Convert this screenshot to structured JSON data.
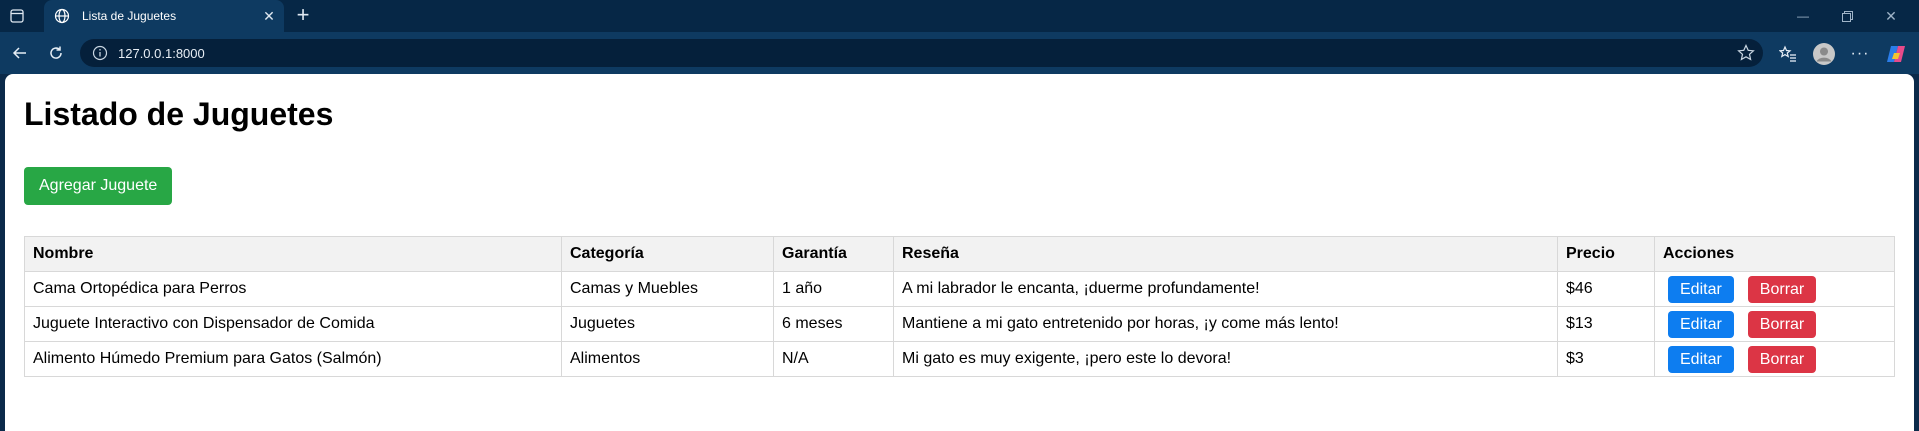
{
  "browser": {
    "tab_title": "Lista de Juguetes",
    "url": "127.0.0.1:8000"
  },
  "page": {
    "heading": "Listado de Juguetes",
    "add_button": "Agregar Juguete",
    "table": {
      "headers": [
        "Nombre",
        "Categoría",
        "Garantía",
        "Reseña",
        "Precio",
        "Acciones"
      ],
      "rows": [
        {
          "nombre": "Cama Ortopédica para Perros",
          "categoria": "Camas y Muebles",
          "garantia": "1 año",
          "resena": "A mi labrador le encanta, ¡duerme profundamente!",
          "precio": "$46"
        },
        {
          "nombre": "Juguete Interactivo con Dispensador de Comida",
          "categoria": "Juguetes",
          "garantia": "6 meses",
          "resena": "Mantiene a mi gato entretenido por horas, ¡y come más lento!",
          "precio": "$13"
        },
        {
          "nombre": "Alimento Húmedo Premium para Gatos (Salmón)",
          "categoria": "Alimentos",
          "garantia": "N/A",
          "resena": "Mi gato es muy exigente, ¡pero este lo devora!",
          "precio": "$3"
        }
      ],
      "edit_label": "Editar",
      "delete_label": "Borrar"
    }
  },
  "colors": {
    "add_button": "#28a745",
    "edit_button": "#0d7df0",
    "delete_button": "#dc3545"
  }
}
